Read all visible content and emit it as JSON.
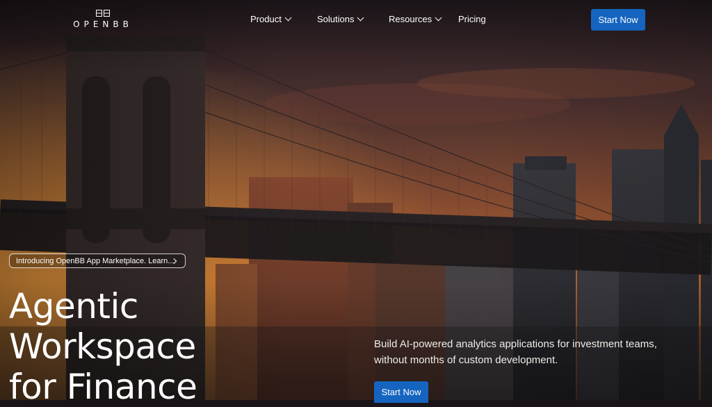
{
  "brand": {
    "name": "OPENBB",
    "logo_icon": "openbb-logo-icon"
  },
  "nav": {
    "items": [
      {
        "label": "Product",
        "has_dropdown": true
      },
      {
        "label": "Solutions",
        "has_dropdown": true
      },
      {
        "label": "Resources",
        "has_dropdown": true
      },
      {
        "label": "Pricing",
        "has_dropdown": false
      }
    ],
    "cta_label": "Start Now"
  },
  "hero": {
    "announcement": "Introducing OpenBB App Marketplace. Learn...",
    "headline_lines": [
      "Agentic",
      "Workspace",
      "for Finance"
    ],
    "subtext": "Build AI-powered analytics applications for investment teams, without months of custom development.",
    "cta_label": "Start Now",
    "background": "brooklyn-bridge-sunset-photo"
  },
  "colors": {
    "accent": "#1564c0",
    "text": "#ffffff"
  }
}
